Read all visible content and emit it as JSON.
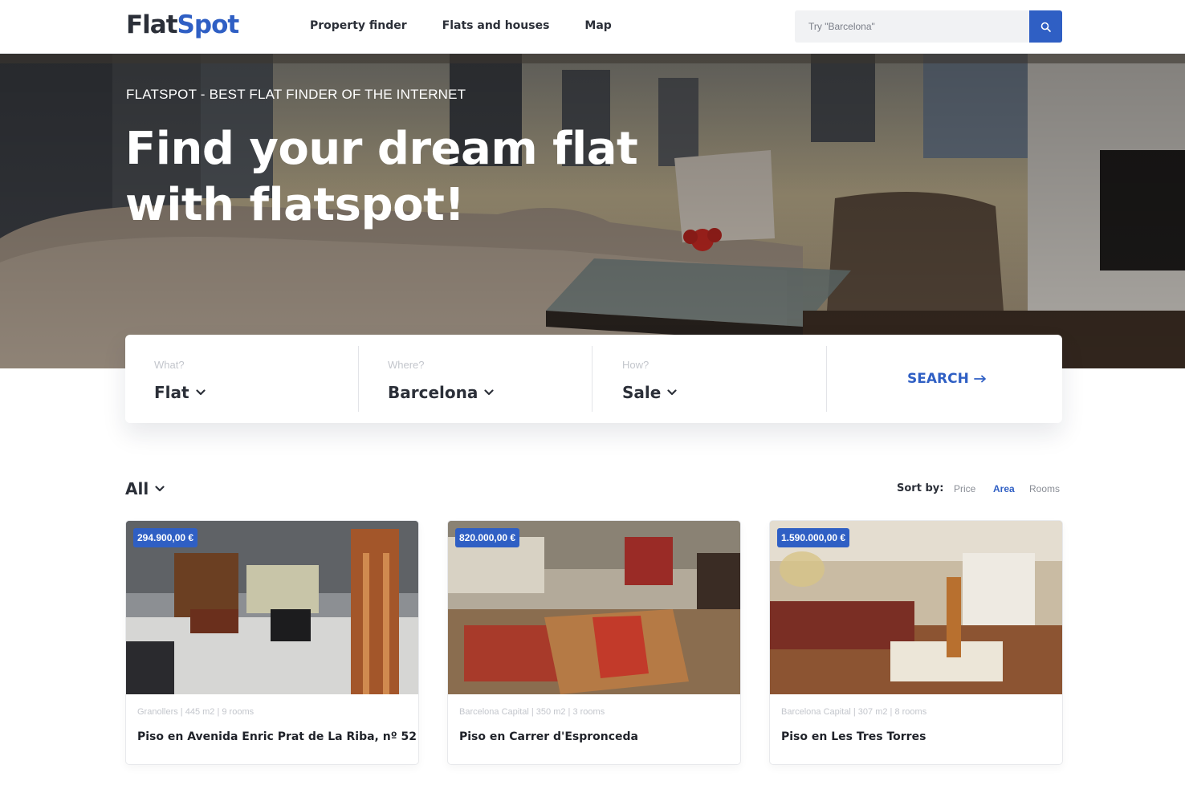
{
  "brand": {
    "name_part1": "Flat",
    "name_part2": "Spot",
    "color": "#2f5fc4"
  },
  "nav": {
    "items": [
      "Property finder",
      "Flats and houses",
      "Map"
    ]
  },
  "search": {
    "placeholder": "Try \"Barcelona\"",
    "button_icon": "search-icon"
  },
  "hero": {
    "kicker": "FLATSPOT - BEST FLAT FINDER OF THE INTERNET",
    "title": "Find your dream flat with flatspot!"
  },
  "search_panel": {
    "fields": [
      {
        "label": "What?",
        "value": "Flat"
      },
      {
        "label": "Where?",
        "value": "Barcelona"
      },
      {
        "label": "How?",
        "value": "Sale"
      }
    ],
    "submit_label": "SEARCH"
  },
  "filter": {
    "category": "All",
    "sort_label": "Sort by:",
    "sort_options": [
      "Price",
      "Area",
      "Rooms"
    ],
    "active_sort": "Area"
  },
  "listings": [
    {
      "price": "294.900,00 €",
      "meta": "Granollers | 445 m2 | 9 rooms",
      "title": "Piso en Avenida Enric Prat de La Riba, nº 52"
    },
    {
      "price": "820.000,00 €",
      "meta": "Barcelona Capital | 350 m2 | 3 rooms",
      "title": "Piso en Carrer d'Espronceda"
    },
    {
      "price": "1.590.000,00 €",
      "meta": "Barcelona Capital | 307 m2 | 8 rooms",
      "title": "Piso en Les Tres Torres"
    }
  ]
}
